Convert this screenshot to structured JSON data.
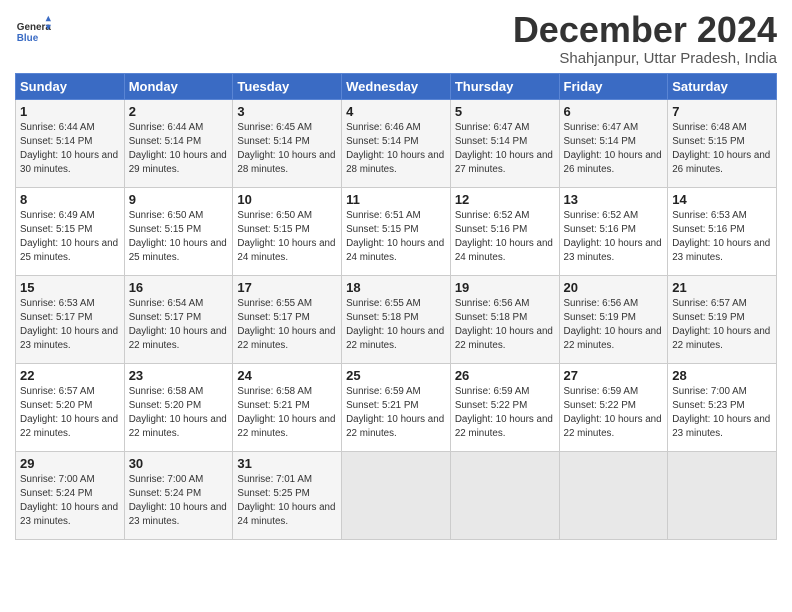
{
  "header": {
    "logo_line1": "General",
    "logo_line2": "Blue",
    "title": "December 2024",
    "subtitle": "Shahjanpur, Uttar Pradesh, India"
  },
  "weekdays": [
    "Sunday",
    "Monday",
    "Tuesday",
    "Wednesday",
    "Thursday",
    "Friday",
    "Saturday"
  ],
  "weeks": [
    [
      {
        "day": "1",
        "sunrise": "6:44 AM",
        "sunset": "5:14 PM",
        "daylight": "10 hours and 30 minutes."
      },
      {
        "day": "2",
        "sunrise": "6:44 AM",
        "sunset": "5:14 PM",
        "daylight": "10 hours and 29 minutes."
      },
      {
        "day": "3",
        "sunrise": "6:45 AM",
        "sunset": "5:14 PM",
        "daylight": "10 hours and 28 minutes."
      },
      {
        "day": "4",
        "sunrise": "6:46 AM",
        "sunset": "5:14 PM",
        "daylight": "10 hours and 28 minutes."
      },
      {
        "day": "5",
        "sunrise": "6:47 AM",
        "sunset": "5:14 PM",
        "daylight": "10 hours and 27 minutes."
      },
      {
        "day": "6",
        "sunrise": "6:47 AM",
        "sunset": "5:14 PM",
        "daylight": "10 hours and 26 minutes."
      },
      {
        "day": "7",
        "sunrise": "6:48 AM",
        "sunset": "5:15 PM",
        "daylight": "10 hours and 26 minutes."
      }
    ],
    [
      {
        "day": "8",
        "sunrise": "6:49 AM",
        "sunset": "5:15 PM",
        "daylight": "10 hours and 25 minutes."
      },
      {
        "day": "9",
        "sunrise": "6:50 AM",
        "sunset": "5:15 PM",
        "daylight": "10 hours and 25 minutes."
      },
      {
        "day": "10",
        "sunrise": "6:50 AM",
        "sunset": "5:15 PM",
        "daylight": "10 hours and 24 minutes."
      },
      {
        "day": "11",
        "sunrise": "6:51 AM",
        "sunset": "5:15 PM",
        "daylight": "10 hours and 24 minutes."
      },
      {
        "day": "12",
        "sunrise": "6:52 AM",
        "sunset": "5:16 PM",
        "daylight": "10 hours and 24 minutes."
      },
      {
        "day": "13",
        "sunrise": "6:52 AM",
        "sunset": "5:16 PM",
        "daylight": "10 hours and 23 minutes."
      },
      {
        "day": "14",
        "sunrise": "6:53 AM",
        "sunset": "5:16 PM",
        "daylight": "10 hours and 23 minutes."
      }
    ],
    [
      {
        "day": "15",
        "sunrise": "6:53 AM",
        "sunset": "5:17 PM",
        "daylight": "10 hours and 23 minutes."
      },
      {
        "day": "16",
        "sunrise": "6:54 AM",
        "sunset": "5:17 PM",
        "daylight": "10 hours and 22 minutes."
      },
      {
        "day": "17",
        "sunrise": "6:55 AM",
        "sunset": "5:17 PM",
        "daylight": "10 hours and 22 minutes."
      },
      {
        "day": "18",
        "sunrise": "6:55 AM",
        "sunset": "5:18 PM",
        "daylight": "10 hours and 22 minutes."
      },
      {
        "day": "19",
        "sunrise": "6:56 AM",
        "sunset": "5:18 PM",
        "daylight": "10 hours and 22 minutes."
      },
      {
        "day": "20",
        "sunrise": "6:56 AM",
        "sunset": "5:19 PM",
        "daylight": "10 hours and 22 minutes."
      },
      {
        "day": "21",
        "sunrise": "6:57 AM",
        "sunset": "5:19 PM",
        "daylight": "10 hours and 22 minutes."
      }
    ],
    [
      {
        "day": "22",
        "sunrise": "6:57 AM",
        "sunset": "5:20 PM",
        "daylight": "10 hours and 22 minutes."
      },
      {
        "day": "23",
        "sunrise": "6:58 AM",
        "sunset": "5:20 PM",
        "daylight": "10 hours and 22 minutes."
      },
      {
        "day": "24",
        "sunrise": "6:58 AM",
        "sunset": "5:21 PM",
        "daylight": "10 hours and 22 minutes."
      },
      {
        "day": "25",
        "sunrise": "6:59 AM",
        "sunset": "5:21 PM",
        "daylight": "10 hours and 22 minutes."
      },
      {
        "day": "26",
        "sunrise": "6:59 AM",
        "sunset": "5:22 PM",
        "daylight": "10 hours and 22 minutes."
      },
      {
        "day": "27",
        "sunrise": "6:59 AM",
        "sunset": "5:22 PM",
        "daylight": "10 hours and 22 minutes."
      },
      {
        "day": "28",
        "sunrise": "7:00 AM",
        "sunset": "5:23 PM",
        "daylight": "10 hours and 23 minutes."
      }
    ],
    [
      {
        "day": "29",
        "sunrise": "7:00 AM",
        "sunset": "5:24 PM",
        "daylight": "10 hours and 23 minutes."
      },
      {
        "day": "30",
        "sunrise": "7:00 AM",
        "sunset": "5:24 PM",
        "daylight": "10 hours and 23 minutes."
      },
      {
        "day": "31",
        "sunrise": "7:01 AM",
        "sunset": "5:25 PM",
        "daylight": "10 hours and 24 minutes."
      },
      null,
      null,
      null,
      null
    ]
  ],
  "labels": {
    "sunrise_prefix": "Sunrise: ",
    "sunset_prefix": "Sunset: ",
    "daylight_prefix": "Daylight: "
  }
}
